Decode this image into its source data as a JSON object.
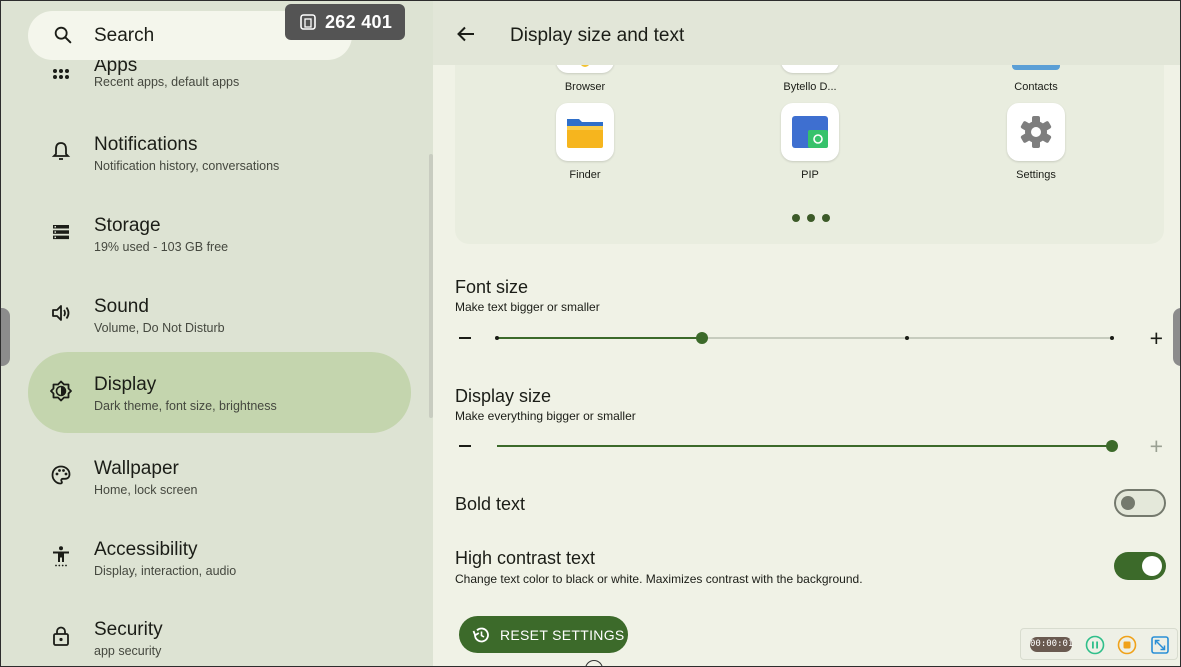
{
  "search": {
    "placeholder": "Search"
  },
  "counter": {
    "value": "262 401"
  },
  "sidebar": {
    "items": [
      {
        "title": "Apps",
        "subtitle": "Recent apps, default apps"
      },
      {
        "title": "Notifications",
        "subtitle": "Notification history, conversations"
      },
      {
        "title": "Storage",
        "subtitle": "19% used - 103 GB free"
      },
      {
        "title": "Sound",
        "subtitle": "Volume, Do Not Disturb"
      },
      {
        "title": "Display",
        "subtitle": "Dark theme, font size, brightness"
      },
      {
        "title": "Wallpaper",
        "subtitle": "Home, lock screen"
      },
      {
        "title": "Accessibility",
        "subtitle": "Display, interaction, audio"
      },
      {
        "title": "Security",
        "subtitle": "app security"
      }
    ],
    "active_item": "Display"
  },
  "header": {
    "title": "Display size and text"
  },
  "preview": {
    "apps": [
      {
        "label": "Browser",
        "icon": "browser-icon"
      },
      {
        "label": "Bytello D...",
        "icon": "bytello-icon"
      },
      {
        "label": "Contacts",
        "icon": "contacts-icon"
      },
      {
        "label": "Finder",
        "icon": "finder-folder-icon"
      },
      {
        "label": "PIP",
        "icon": "pip-icon"
      },
      {
        "label": "Settings",
        "icon": "settings-gear-icon"
      }
    ]
  },
  "font_size": {
    "title": "Font size",
    "subtitle": "Make text bigger or smaller",
    "level": 1,
    "levels": 4
  },
  "display_size": {
    "title": "Display size",
    "subtitle": "Make everything bigger or smaller",
    "level_fraction": 1.0
  },
  "bold_text": {
    "title": "Bold text",
    "enabled": false
  },
  "high_contrast": {
    "title": "High contrast text",
    "subtitle": "Change text color to black or white. Maximizes contrast with the background.",
    "enabled": true
  },
  "reset": {
    "label": "RESET SETTINGS"
  },
  "recorder": {
    "time": "00:00:01"
  },
  "colors": {
    "accent": "#3c6a2a",
    "active_item_bg": "#c4d5ae",
    "sidebar_bg": "#dde3d3",
    "content_bg": "#f0f2e6"
  }
}
